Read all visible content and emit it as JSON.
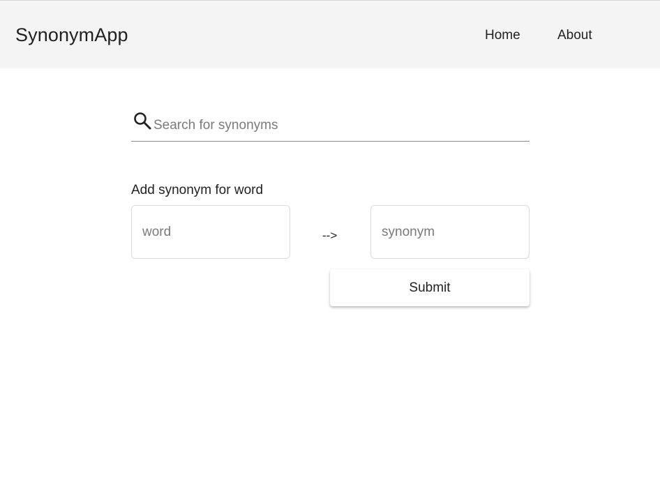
{
  "app": {
    "brand": "SynonymApp"
  },
  "nav": {
    "items": [
      {
        "label": "Home"
      },
      {
        "label": "About"
      }
    ]
  },
  "search": {
    "icon": "search-icon",
    "value": "",
    "placeholder": "Search for synonyms"
  },
  "add_synonym": {
    "heading": "Add synonym for word",
    "word_field": {
      "value": "",
      "placeholder": "word"
    },
    "arrow": "-->",
    "synonym_field": {
      "value": "",
      "placeholder": "synonym"
    },
    "submit_label": "Submit"
  },
  "colors": {
    "appbar_bg": "#f4f4f4",
    "page_bg": "#ffffff",
    "text": "#212121",
    "placeholder": "#7a7a7a",
    "field_border": "#dadada",
    "underline": "#8a8a8a"
  }
}
